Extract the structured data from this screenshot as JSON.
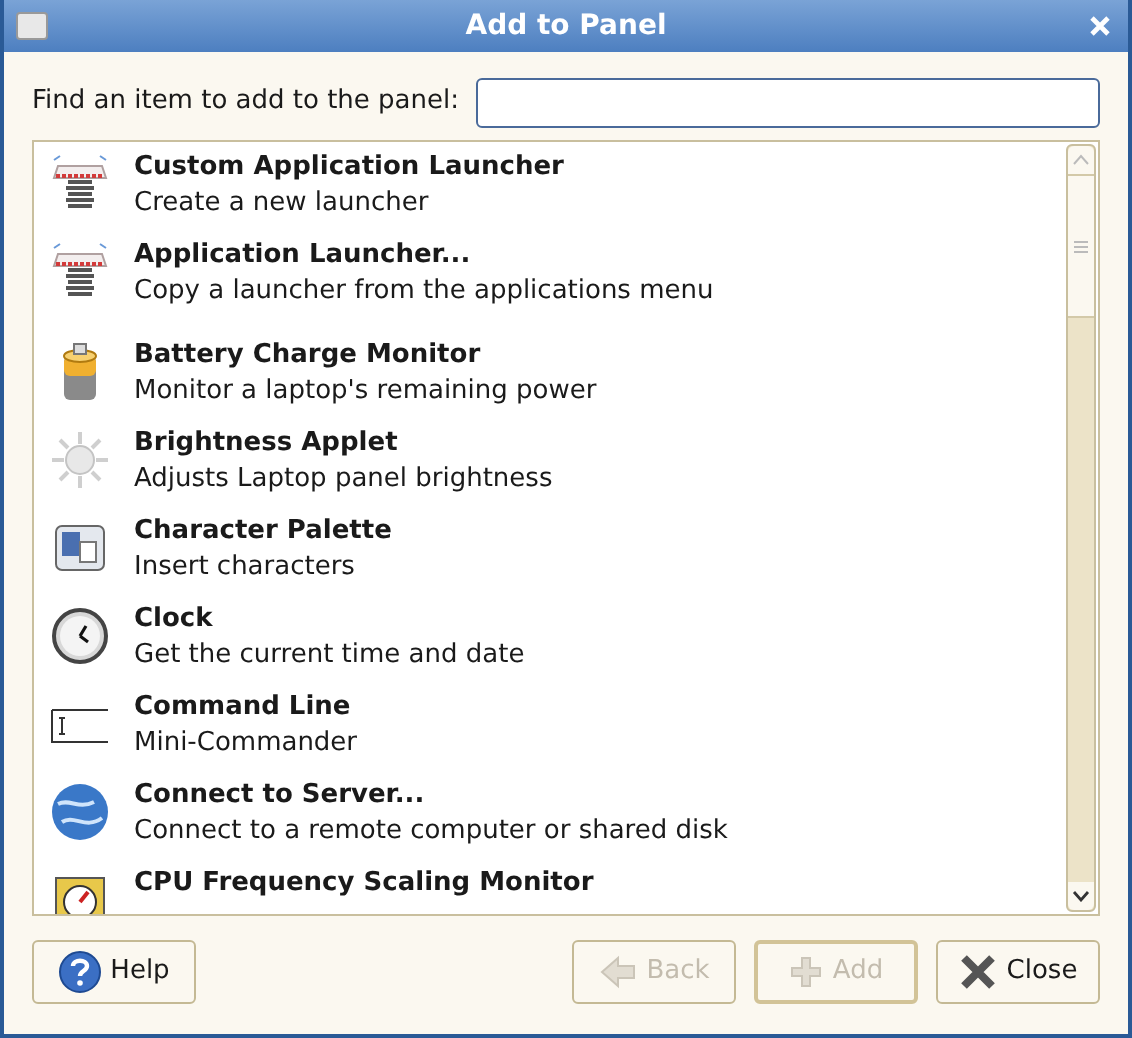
{
  "window": {
    "title": "Add to Panel"
  },
  "search": {
    "label": "Find an item to add to the panel:"
  },
  "items": [
    {
      "kind": "entry",
      "name": "Custom Application Launcher",
      "description": "Create a new launcher"
    },
    {
      "kind": "entry",
      "name": "Application Launcher...",
      "description": "Copy a launcher from the applications menu"
    },
    {
      "kind": "separator"
    },
    {
      "kind": "entry",
      "name": "Battery Charge Monitor",
      "description": "Monitor a laptop's remaining power"
    },
    {
      "kind": "entry",
      "name": "Brightness Applet",
      "description": "Adjusts Laptop panel brightness"
    },
    {
      "kind": "entry",
      "name": "Character Palette",
      "description": "Insert characters"
    },
    {
      "kind": "entry",
      "name": "Clock",
      "description": "Get the current time and date"
    },
    {
      "kind": "entry",
      "name": "Command Line",
      "description": "Mini-Commander"
    },
    {
      "kind": "entry",
      "name": "Connect to Server...",
      "description": "Connect to a remote computer or shared disk"
    },
    {
      "kind": "entry",
      "name": "CPU Frequency Scaling Monitor"
    }
  ],
  "buttons": [
    {
      "label": "Help",
      "disabled": false,
      "default": false
    },
    {
      "label": "Back",
      "disabled": true,
      "default": false
    },
    {
      "label": "Add",
      "disabled": true,
      "default": true
    },
    {
      "label": "Close",
      "disabled": false,
      "default": false
    }
  ]
}
